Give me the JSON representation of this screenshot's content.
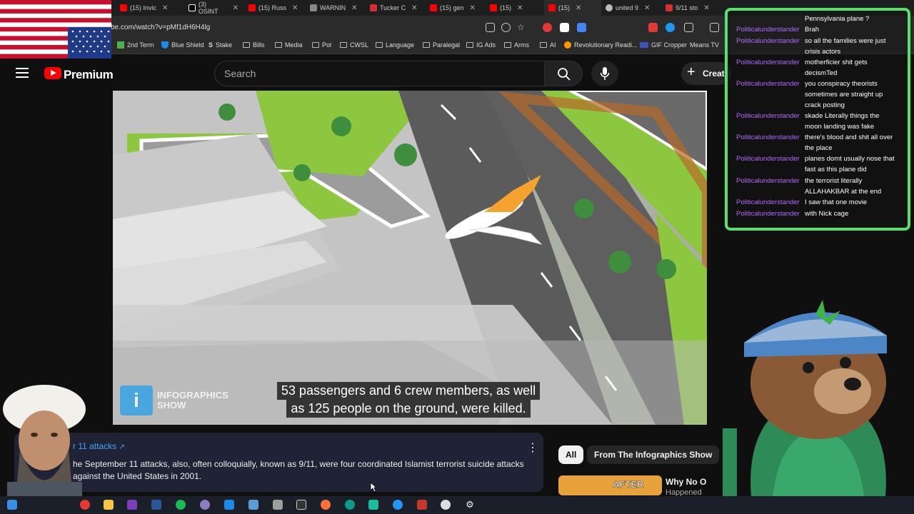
{
  "browser": {
    "tabs": [
      {
        "label": "(15) Invic",
        "color": "#ff0000"
      },
      {
        "label": "(3) OSINT",
        "color": "#ffffff"
      },
      {
        "label": "(15) Russ",
        "color": "#ff0000"
      },
      {
        "label": "WARNIN",
        "color": "#cccccc"
      },
      {
        "label": "Tucker C",
        "color": "#d32f2f"
      },
      {
        "label": "(15) gen",
        "color": "#ff0000"
      },
      {
        "label": "(15)",
        "color": "#ff0000"
      },
      {
        "label": "(15)",
        "color": "#ff0000"
      },
      {
        "label": "united 9",
        "color": "#cccccc"
      },
      {
        "label": "9/11 sto",
        "color": "#d32f2f"
      }
    ],
    "url": "be.com/watch?v=pMf1dH6H4lg",
    "bookmarks": [
      "2nd Term",
      "Blue Shield",
      "Stake",
      "Bills",
      "Media",
      "Pol",
      "CWSL",
      "Language",
      "Paralegal",
      "IG Ads",
      "Arms",
      "AI",
      "Revolutionary Readi...",
      "GIF Cropper",
      "Means TV"
    ]
  },
  "youtube": {
    "brand": "Premium",
    "search_placeholder": "Search",
    "create_label": "Creat"
  },
  "video": {
    "caption_line1": "53 passengers and 6 crew members, as well",
    "caption_line2": "as 125 people on the ground, were killed.",
    "watermark_logo": "i",
    "watermark_line1": "INFOGRAPHICS",
    "watermark_line2": "SHOW"
  },
  "info_panel": {
    "title": "r 11 attacks",
    "body": "he September 11 attacks, also, often colloquially, known as 9/11, were four coordinated Islamist terrorist suicide attacks against the United States in 2001.",
    "more": "⋮"
  },
  "chips": {
    "all": "All",
    "from": "From The Infographics Show"
  },
  "recommendation": {
    "thumb_text": "AFTER",
    "title": "Why No O",
    "subtitle": "Happened"
  },
  "chat": {
    "username": "Politicalunderstander",
    "messages": [
      {
        "text": "Pennsylvania plane ?",
        "show_user": false
      },
      {
        "text": "Brah",
        "show_user": true
      },
      {
        "text": "so all the families were just crisis actors",
        "show_user": true
      },
      {
        "text": "motherficier shit gets decismTed",
        "show_user": true
      },
      {
        "text": "you conspiracy theorists sometimes are straight up crack posting",
        "show_user": true
      },
      {
        "text": "skade Literally things the moon landing was fake",
        "show_user": true
      },
      {
        "text": "there's blood and shit all over the place",
        "show_user": true
      },
      {
        "text": "planes domt usually nose that fast as this plane did",
        "show_user": true
      },
      {
        "text": "the terrorist literally ALLAHAKBAR at the end",
        "show_user": true
      },
      {
        "text": "I saw that one movie",
        "show_user": true
      },
      {
        "text": "with Nick cage",
        "show_user": true
      }
    ]
  },
  "colors": {
    "chat_border": "#54e36a",
    "chat_user": "#b46bff",
    "link": "#3ea6ff",
    "yt_red": "#ff0000"
  },
  "icons": [
    "menu-icon",
    "youtube-logo-icon",
    "search-icon",
    "mic-icon",
    "plus-icon",
    "external-link-icon",
    "more-vert-icon",
    "windows-start-icon",
    "chrome-icon",
    "folder-icon",
    "settings-icon"
  ]
}
